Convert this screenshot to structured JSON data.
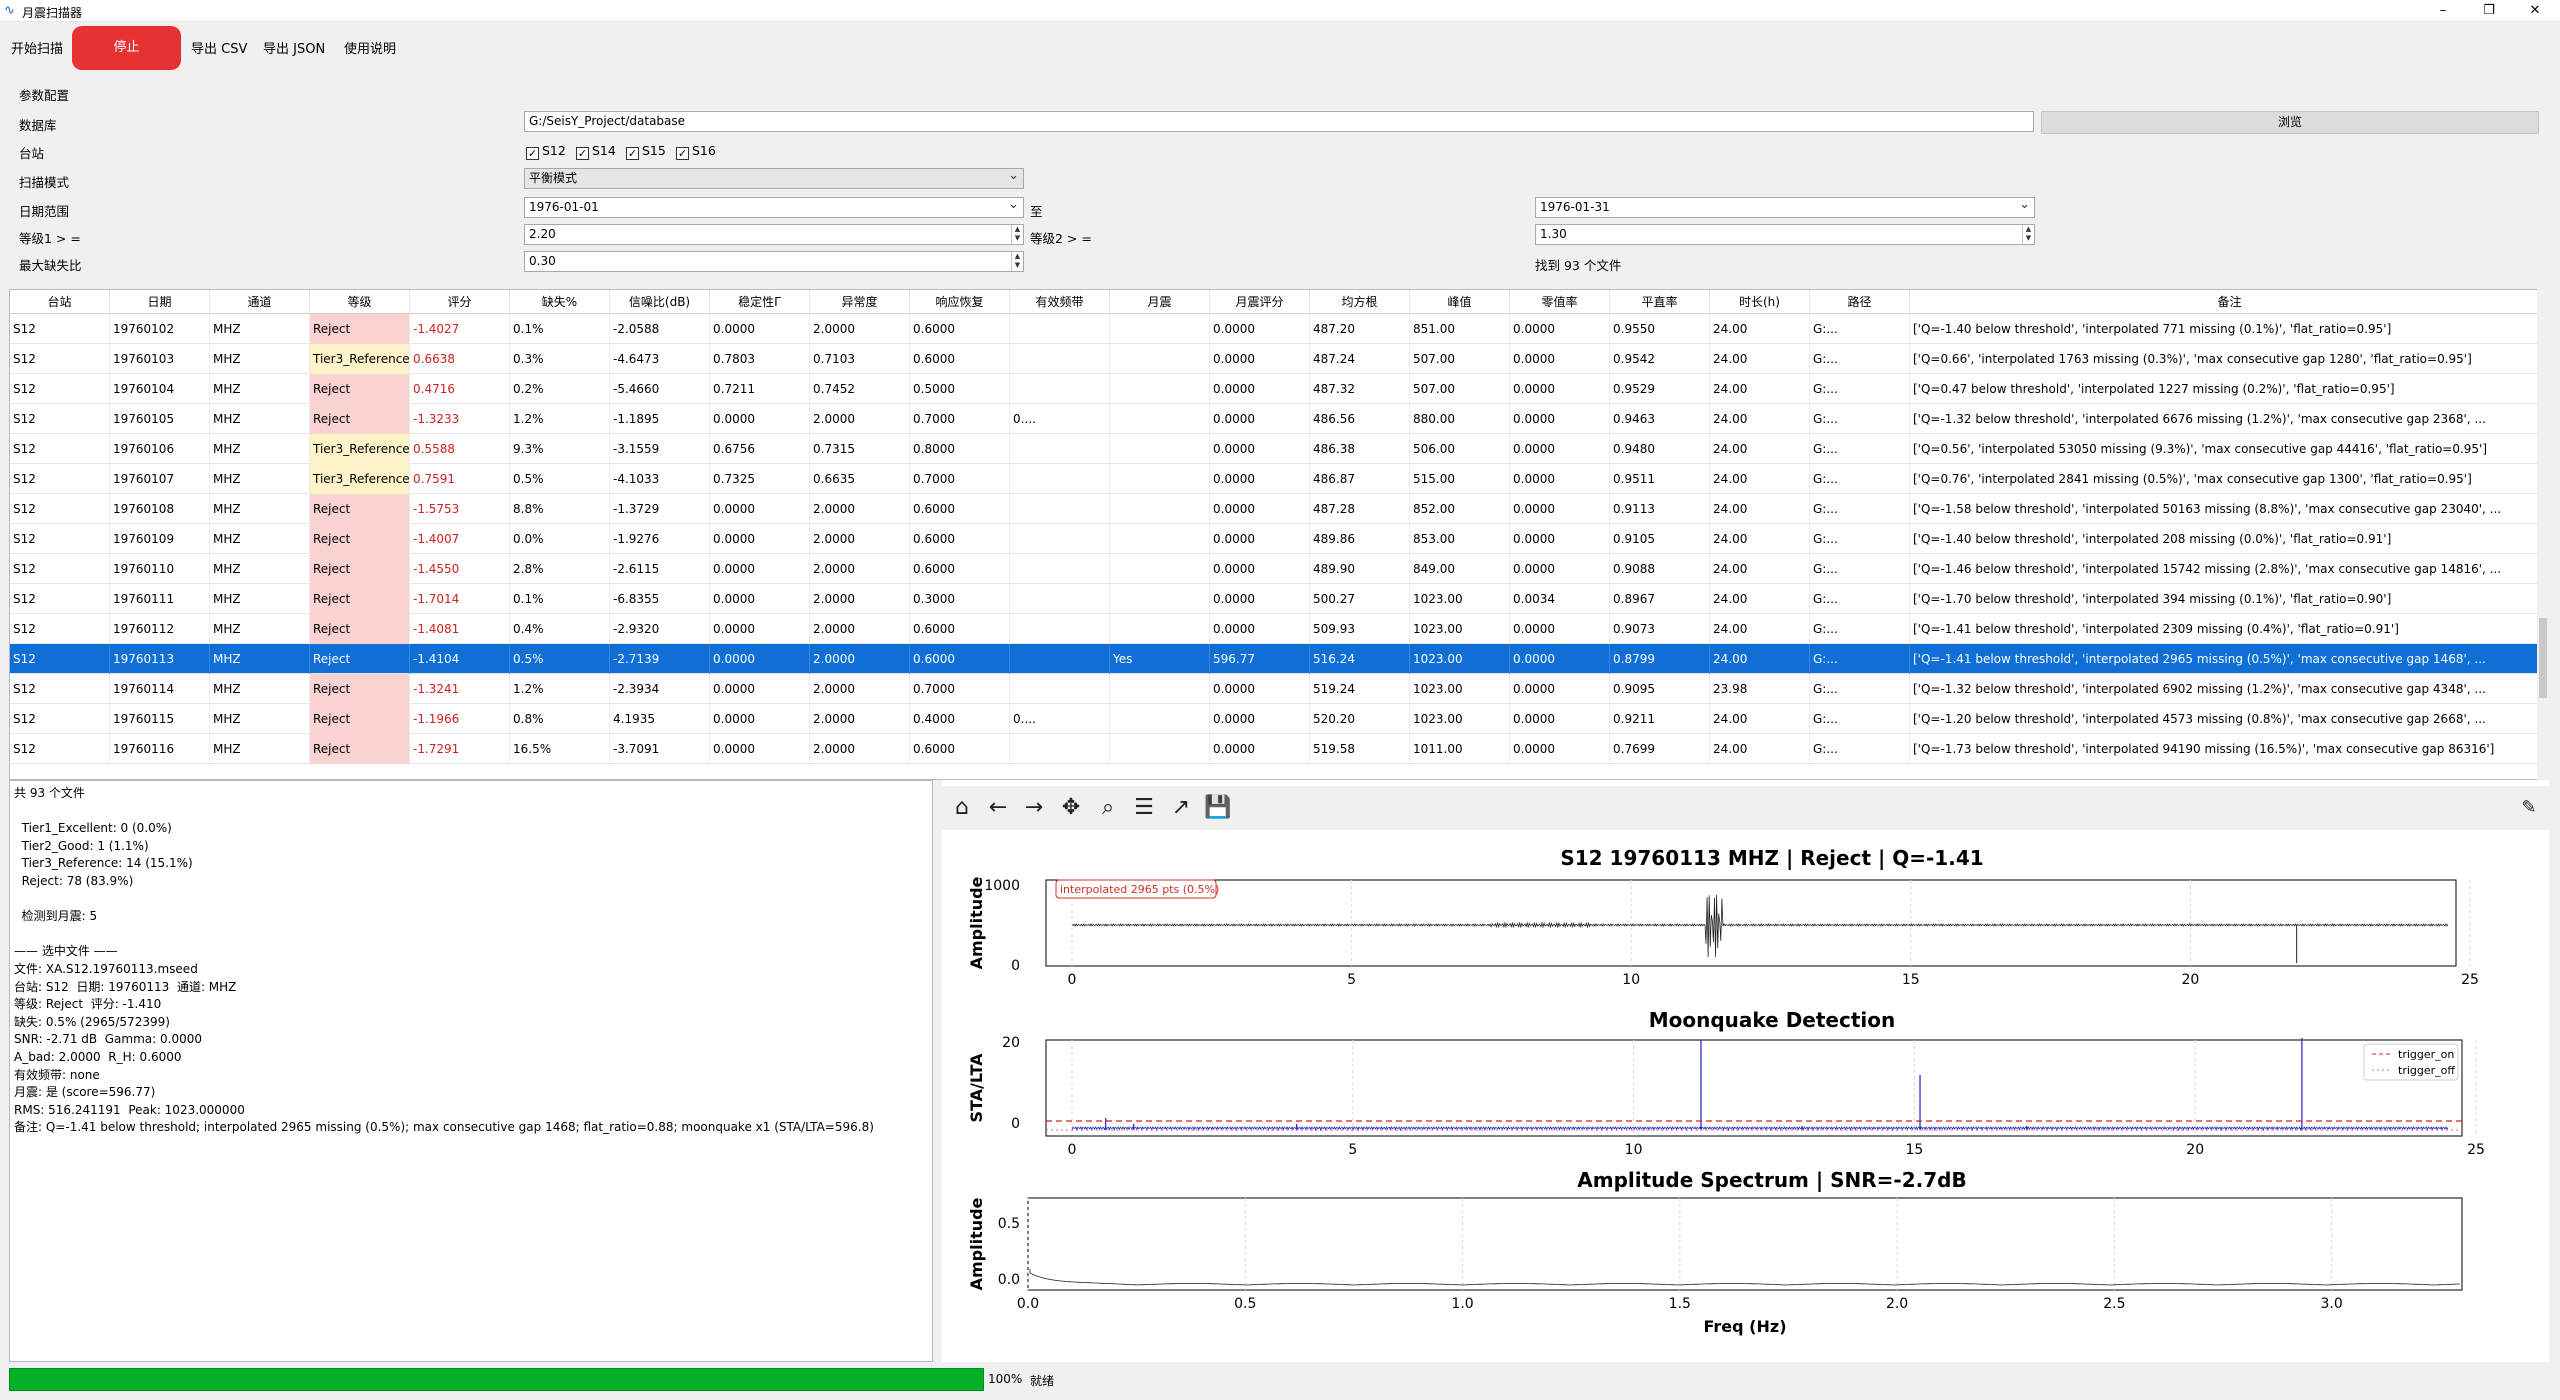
{
  "window": {
    "title": "月震扫描器",
    "minimize": "–",
    "maximize": "❐",
    "close": "✕"
  },
  "toolbar": {
    "start": "开始扫描",
    "stop": "停止",
    "export_csv": "导出 CSV",
    "export_json": "导出 JSON",
    "help": "使用说明"
  },
  "params": {
    "group_title": "参数配置",
    "db_label": "数据库",
    "db_value": "G:/SeisY_Project/database",
    "browse": "浏览",
    "station_label": "台站",
    "stations": [
      {
        "name": "S12",
        "checked": true
      },
      {
        "name": "S14",
        "checked": true
      },
      {
        "name": "S15",
        "checked": true
      },
      {
        "name": "S16",
        "checked": true
      }
    ],
    "mode_label": "扫描模式",
    "mode_value": "平衡模式",
    "date_label": "日期范围",
    "date_from": "1976-01-01",
    "date_to_label": "至",
    "date_to": "1976-01-31",
    "level1_label": "等级1 > =",
    "level1_value": "2.20",
    "level2_label": "等级2 > =",
    "level2_value": "1.30",
    "max_missing_label": "最大缺失比",
    "max_missing_value": "0.30",
    "found": "找到 93 个文件"
  },
  "table": {
    "headers": [
      "台站",
      "日期",
      "通道",
      "等级",
      "评分",
      "缺失%",
      "信噪比(dB)",
      "稳定性Γ",
      "异常度",
      "响应恢复",
      "有效频带",
      "月震",
      "月震评分",
      "均方根",
      "峰值",
      "零值率",
      "平直率",
      "时长(h)",
      "路径",
      "备注"
    ],
    "rows": [
      [
        "S12",
        "19760102",
        "MHZ",
        "Reject",
        "-1.4027",
        "0.1%",
        "-2.0588",
        "0.0000",
        "2.0000",
        "0.6000",
        "",
        "",
        "0.0000",
        "487.20",
        "851.00",
        "0.0000",
        "0.9550",
        "24.00",
        "G:...",
        "['Q=-1.40 below threshold', 'interpolated 771 missing (0.1%)', 'flat_ratio=0.95']"
      ],
      [
        "S12",
        "19760103",
        "MHZ",
        "Tier3_Reference",
        "0.6638",
        "0.3%",
        "-4.6473",
        "0.7803",
        "0.7103",
        "0.6000",
        "",
        "",
        "0.0000",
        "487.24",
        "507.00",
        "0.0000",
        "0.9542",
        "24.00",
        "G:...",
        "['Q=0.66', 'interpolated 1763 missing (0.3%)', 'max consecutive gap 1280', 'flat_ratio=0.95']"
      ],
      [
        "S12",
        "19760104",
        "MHZ",
        "Reject",
        "0.4716",
        "0.2%",
        "-5.4660",
        "0.7211",
        "0.7452",
        "0.5000",
        "",
        "",
        "0.0000",
        "487.32",
        "507.00",
        "0.0000",
        "0.9529",
        "24.00",
        "G:...",
        "['Q=0.47 below threshold', 'interpolated 1227 missing (0.2%)', 'flat_ratio=0.95']"
      ],
      [
        "S12",
        "19760105",
        "MHZ",
        "Reject",
        "-1.3233",
        "1.2%",
        "-1.1895",
        "0.0000",
        "2.0000",
        "0.7000",
        "0....",
        "",
        "0.0000",
        "486.56",
        "880.00",
        "0.0000",
        "0.9463",
        "24.00",
        "G:...",
        "['Q=-1.32 below threshold', 'interpolated 6676 missing (1.2%)', 'max consecutive gap 2368', ..."
      ],
      [
        "S12",
        "19760106",
        "MHZ",
        "Tier3_Reference",
        "0.5588",
        "9.3%",
        "-3.1559",
        "0.6756",
        "0.7315",
        "0.8000",
        "",
        "",
        "0.0000",
        "486.38",
        "506.00",
        "0.0000",
        "0.9480",
        "24.00",
        "G:...",
        "['Q=0.56', 'interpolated 53050 missing (9.3%)', 'max consecutive gap 44416', 'flat_ratio=0.95']"
      ],
      [
        "S12",
        "19760107",
        "MHZ",
        "Tier3_Reference",
        "0.7591",
        "0.5%",
        "-4.1033",
        "0.7325",
        "0.6635",
        "0.7000",
        "",
        "",
        "0.0000",
        "486.87",
        "515.00",
        "0.0000",
        "0.9511",
        "24.00",
        "G:...",
        "['Q=0.76', 'interpolated 2841 missing (0.5%)', 'max consecutive gap 1300', 'flat_ratio=0.95']"
      ],
      [
        "S12",
        "19760108",
        "MHZ",
        "Reject",
        "-1.5753",
        "8.8%",
        "-1.3729",
        "0.0000",
        "2.0000",
        "0.6000",
        "",
        "",
        "0.0000",
        "487.28",
        "852.00",
        "0.0000",
        "0.9113",
        "24.00",
        "G:...",
        "['Q=-1.58 below threshold', 'interpolated 50163 missing (8.8%)', 'max consecutive gap 23040', ..."
      ],
      [
        "S12",
        "19760109",
        "MHZ",
        "Reject",
        "-1.4007",
        "0.0%",
        "-1.9276",
        "0.0000",
        "2.0000",
        "0.6000",
        "",
        "",
        "0.0000",
        "489.86",
        "853.00",
        "0.0000",
        "0.9105",
        "24.00",
        "G:...",
        "['Q=-1.40 below threshold', 'interpolated 208 missing (0.0%)', 'flat_ratio=0.91']"
      ],
      [
        "S12",
        "19760110",
        "MHZ",
        "Reject",
        "-1.4550",
        "2.8%",
        "-2.6115",
        "0.0000",
        "2.0000",
        "0.6000",
        "",
        "",
        "0.0000",
        "489.90",
        "849.00",
        "0.0000",
        "0.9088",
        "24.00",
        "G:...",
        "['Q=-1.46 below threshold', 'interpolated 15742 missing (2.8%)', 'max consecutive gap 14816', ..."
      ],
      [
        "S12",
        "19760111",
        "MHZ",
        "Reject",
        "-1.7014",
        "0.1%",
        "-6.8355",
        "0.0000",
        "2.0000",
        "0.3000",
        "",
        "",
        "0.0000",
        "500.27",
        "1023.00",
        "0.0034",
        "0.8967",
        "24.00",
        "G:...",
        "['Q=-1.70 below threshold', 'interpolated 394 missing (0.1%)', 'flat_ratio=0.90']"
      ],
      [
        "S12",
        "19760112",
        "MHZ",
        "Reject",
        "-1.4081",
        "0.4%",
        "-2.9320",
        "0.0000",
        "2.0000",
        "0.6000",
        "",
        "",
        "0.0000",
        "509.93",
        "1023.00",
        "0.0000",
        "0.9073",
        "24.00",
        "G:...",
        "['Q=-1.41 below threshold', 'interpolated 2309 missing (0.4%)', 'flat_ratio=0.91']"
      ],
      [
        "S12",
        "19760113",
        "MHZ",
        "Reject",
        "-1.4104",
        "0.5%",
        "-2.7139",
        "0.0000",
        "2.0000",
        "0.6000",
        "",
        "Yes",
        "596.77",
        "516.24",
        "1023.00",
        "0.0000",
        "0.8799",
        "24.00",
        "G:...",
        "['Q=-1.41 below threshold', 'interpolated 2965 missing (0.5%)', 'max consecutive gap 1468', ..."
      ],
      [
        "S12",
        "19760114",
        "MHZ",
        "Reject",
        "-1.3241",
        "1.2%",
        "-2.3934",
        "0.0000",
        "2.0000",
        "0.7000",
        "",
        "",
        "0.0000",
        "519.24",
        "1023.00",
        "0.0000",
        "0.9095",
        "23.98",
        "G:...",
        "['Q=-1.32 below threshold', 'interpolated 6902 missing (1.2%)', 'max consecutive gap 4348', ..."
      ],
      [
        "S12",
        "19760115",
        "MHZ",
        "Reject",
        "-1.1966",
        "0.8%",
        "4.1935",
        "0.0000",
        "2.0000",
        "0.4000",
        "0....",
        "",
        "0.0000",
        "520.20",
        "1023.00",
        "0.0000",
        "0.9211",
        "24.00",
        "G:...",
        "['Q=-1.20 below threshold', 'interpolated 4573 missing (0.8%)', 'max consecutive gap 2668', ..."
      ],
      [
        "S12",
        "19760116",
        "MHZ",
        "Reject",
        "-1.7291",
        "16.5%",
        "-3.7091",
        "0.0000",
        "2.0000",
        "0.6000",
        "",
        "",
        "0.0000",
        "519.58",
        "1011.00",
        "0.0000",
        "0.7699",
        "24.00",
        "G:...",
        "['Q=-1.73 below threshold', 'interpolated 94190 missing (16.5%)', 'max consecutive gap 86316']"
      ]
    ],
    "selected_row": 11,
    "level_colors": {
      "Reject": "#f9d2d2",
      "Tier3_Reference": "#fdf2c8"
    }
  },
  "info": {
    "text": "共 93 个文件\n\n  Tier1_Excellent: 0 (0.0%)\n  Tier2_Good: 1 (1.1%)\n  Tier3_Reference: 14 (15.1%)\n  Reject: 78 (83.9%)\n\n  检测到月震: 5\n\n—— 选中文件 ——\n文件: XA.S12.19760113.mseed\n台站: S12  日期: 19760113  通道: MHZ\n等级: Reject  评分: -1.410\n缺失: 0.5% (2965/572399)\nSNR: -2.71 dB  Gamma: 0.0000\nA_bad: 2.0000  R_H: 0.6000\n有效频带: none\n月震: 是 (score=596.77)\nRMS: 516.241191  Peak: 1023.000000\n备注: Q=-1.41 below threshold; interpolated 2965 missing (0.5%); max consecutive gap 1468; flat_ratio=0.88; moonquake x1 (STA/LTA=596.8)"
  },
  "plot_tools": [
    "home-icon",
    "back-arrow-icon",
    "forward-arrow-icon",
    "pan-icon",
    "zoom-icon",
    "configure-icon",
    "axes-edit-icon",
    "save-icon"
  ],
  "plots": {
    "p1": {
      "title": "S12 19760113 MHZ | Reject | Q=-1.41",
      "ylabel": "Amplitude",
      "annotation": "interpolated 2965 pts (0.5%)",
      "yticks": [
        "1000",
        "0"
      ],
      "xticks": [
        "0",
        "5",
        "10",
        "15",
        "20",
        "25"
      ]
    },
    "p2": {
      "title": "Moonquake Detection",
      "ylabel": "STA/LTA",
      "yticks": [
        "20",
        "0"
      ],
      "xticks": [
        "0",
        "5",
        "10",
        "15",
        "20",
        "25"
      ],
      "legend": [
        "trigger_on",
        "trigger_off"
      ]
    },
    "p3": {
      "title": "Amplitude Spectrum | SNR=-2.7dB",
      "ylabel": "Amplitude",
      "xlabel": "Freq (Hz)",
      "yticks": [
        "0.5",
        "0.0"
      ],
      "xticks": [
        "0.0",
        "0.5",
        "1.0",
        "1.5",
        "2.0",
        "2.5",
        "3.0"
      ]
    }
  },
  "chart_data": [
    {
      "type": "line",
      "title": "S12 19760113 MHZ | Reject | Q=-1.41",
      "ylabel": "Amplitude",
      "xlim": [
        0,
        25
      ],
      "ylim": [
        0,
        1000
      ],
      "series": [
        {
          "values": []
        }
      ]
    },
    {
      "type": "line",
      "title": "Moonquake Detection",
      "ylabel": "STA/LTA",
      "xlim": [
        0,
        25
      ],
      "ylim": [
        0,
        20
      ],
      "legend": "top-right",
      "series": [
        {
          "name": "trigger_on"
        },
        {
          "name": "trigger_off"
        }
      ]
    },
    {
      "type": "line",
      "title": "Amplitude Spectrum | SNR=-2.7dB",
      "xlabel": "Freq (Hz)",
      "ylabel": "Amplitude",
      "xlim": [
        0,
        3.3
      ],
      "ylim": [
        0,
        0.8
      ]
    }
  ],
  "status": {
    "percent": "100%",
    "text": "就绪"
  },
  "colors": {
    "selected": "#0f6fd6",
    "stop": "#e63232",
    "progress": "#06b025",
    "score_neg": "#d02020"
  }
}
